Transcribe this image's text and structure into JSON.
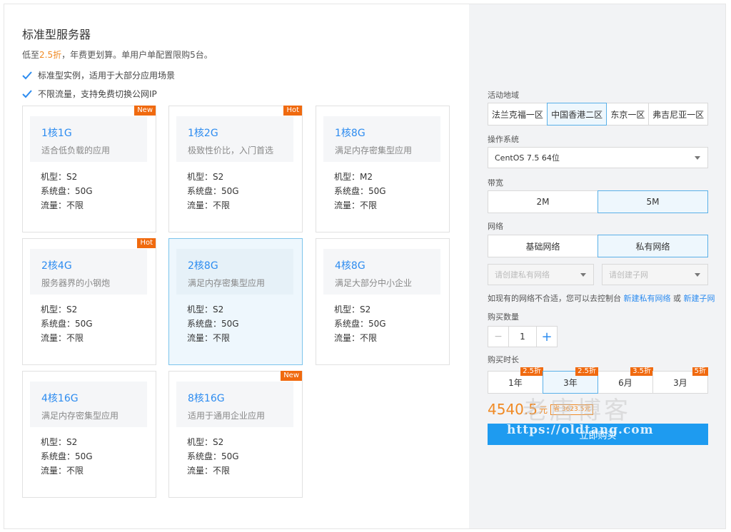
{
  "header": {
    "title": "标准型服务器",
    "subtitle_prefix": "低至",
    "subtitle_discount": "2.5折",
    "subtitle_suffix": "，年费更划算。单用户单配置限购5台。",
    "features": [
      "标准型实例，适用于大部分应用场景",
      "不限流量，支持免费切换公网IP"
    ]
  },
  "plans": [
    {
      "name": "1核1G",
      "desc": "适合低负载的应用",
      "model": "机型：S2",
      "disk": "系统盘：50G",
      "traffic": "流量：不限",
      "tag": "New",
      "selected": false
    },
    {
      "name": "1核2G",
      "desc": "极致性价比，入门首选",
      "model": "机型：S2",
      "disk": "系统盘：50G",
      "traffic": "流量：不限",
      "tag": "Hot",
      "selected": false
    },
    {
      "name": "1核8G",
      "desc": "满足内存密集型应用",
      "model": "机型：M2",
      "disk": "系统盘：50G",
      "traffic": "流量：不限",
      "tag": "",
      "selected": false
    },
    {
      "name": "2核4G",
      "desc": "服务器界的小钢炮",
      "model": "机型：S2",
      "disk": "系统盘：50G",
      "traffic": "流量：不限",
      "tag": "Hot",
      "selected": false
    },
    {
      "name": "2核8G",
      "desc": "满足内存密集型应用",
      "model": "机型：S2",
      "disk": "系统盘：50G",
      "traffic": "流量：不限",
      "tag": "",
      "selected": true
    },
    {
      "name": "4核8G",
      "desc": "满足大部分中小企业",
      "model": "机型：S2",
      "disk": "系统盘：50G",
      "traffic": "流量：不限",
      "tag": "",
      "selected": false
    },
    {
      "name": "4核16G",
      "desc": "满足内存密集型应用",
      "model": "机型：S2",
      "disk": "系统盘：50G",
      "traffic": "流量：不限",
      "tag": "",
      "selected": false
    },
    {
      "name": "8核16G",
      "desc": "适用于通用企业应用",
      "model": "机型：S2",
      "disk": "系统盘：50G",
      "traffic": "流量：不限",
      "tag": "New",
      "selected": false
    }
  ],
  "config": {
    "region_label": "活动地域",
    "regions": [
      "法兰克福一区",
      "中国香港二区",
      "东京一区",
      "弗吉尼亚一区"
    ],
    "region_selected": "中国香港二区",
    "os_label": "操作系统",
    "os_value": "CentOS 7.5 64位",
    "bandwidth_label": "带宽",
    "bandwidths": [
      "2M",
      "5M"
    ],
    "bandwidth_selected": "5M",
    "network_label": "网络",
    "networks": [
      "基础网络",
      "私有网络"
    ],
    "network_selected": "私有网络",
    "vpc_placeholder": "请创建私有网络",
    "subnet_placeholder": "请创建子网",
    "hint_prefix": "如现有的网络不合适，您可以去控制台",
    "hint_link1": "新建私有网络",
    "hint_or": "或",
    "hint_link2": "新建子网",
    "quantity_label": "购买数量",
    "quantity_minus": "−",
    "quantity": "1",
    "quantity_plus": "+",
    "duration_label": "购买时长",
    "durations": [
      {
        "label": "1年",
        "discount": "2.5折"
      },
      {
        "label": "3年",
        "discount": "2.5折"
      },
      {
        "label": "6月",
        "discount": "3.5折"
      },
      {
        "label": "3月",
        "discount": "5折"
      }
    ],
    "duration_selected": "3年",
    "price": "4540.5",
    "price_unit": "元",
    "price_save": "省 3623.5元",
    "buy_label": "立即购买"
  },
  "watermark": {
    "cn": "老唐博客",
    "url": "https://oldtang.com"
  },
  "colors": {
    "accent": "#2d8cf0",
    "orange": "#f08a24",
    "tag": "#f06a0f",
    "buy_button": "#1e9bf0",
    "panel_bg": "#f2f3f5"
  }
}
